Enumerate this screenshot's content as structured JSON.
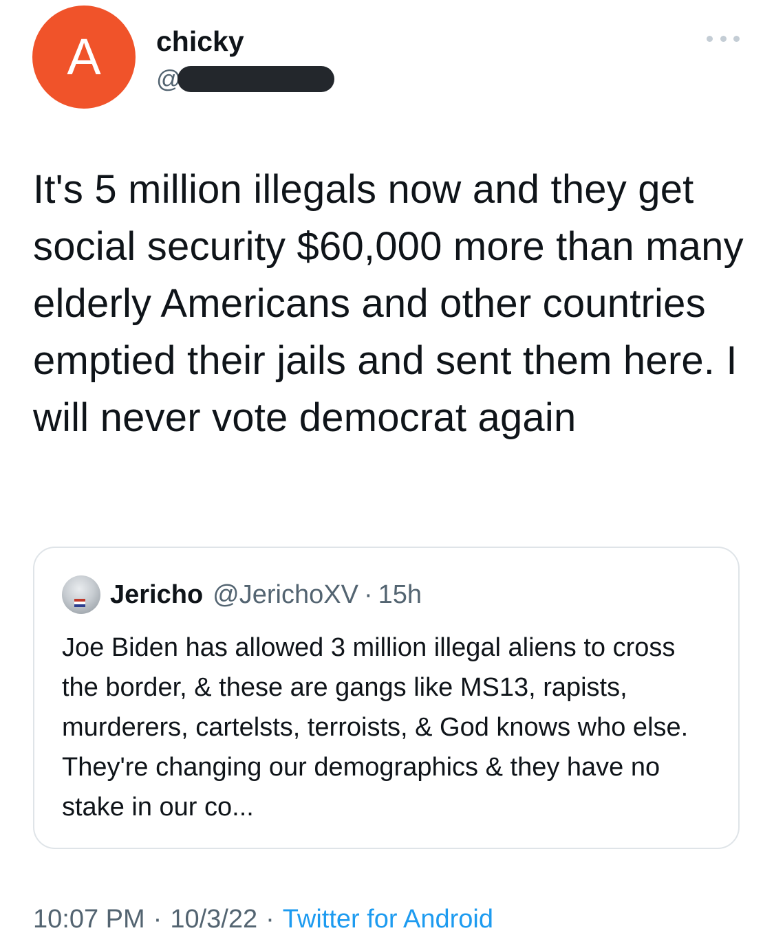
{
  "author": {
    "avatar_letter": "A",
    "avatar_color": "#f0532a",
    "display_name": "chicky",
    "handle_prefix": "@"
  },
  "more_menu_icon": "more-horizontal-icon",
  "tweet": {
    "text": "It's 5 million illegals now and they get social security $60,000 more than many elderly Americans and other countries emptied their jails and sent them here. I will never vote democrat again"
  },
  "quoted_tweet": {
    "display_name": "Jericho",
    "handle": "@JerichoXV",
    "separator": "·",
    "time": "15h",
    "text": "Joe Biden has allowed 3 million illegal aliens to cross the border, & these are gangs like MS13, rapists, murderers, cartelsts, terroists, & God knows who else. They're changing our demographics & they have no stake in our co..."
  },
  "meta": {
    "time": "10:07 PM",
    "date": "10/3/22",
    "source": "Twitter for Android",
    "separator": "·",
    "source_color": "#1d9bf0"
  }
}
